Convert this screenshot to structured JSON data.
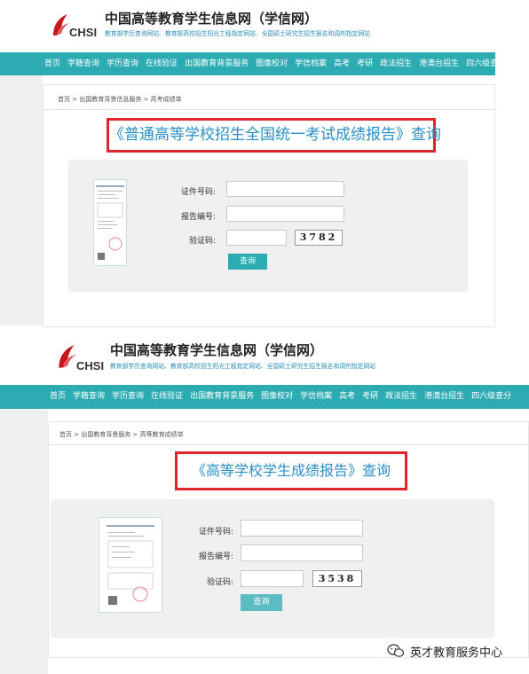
{
  "panel1": {
    "logo_text": "CHSI",
    "site_title": "中国高等教育学生信息网（学信网）",
    "site_subtitle": "教育部学历查询网站、教育部高校招生阳光工程指定网站、全国硕士研究生招生报名和调剂指定网站",
    "nav": [
      "首页",
      "学籍查询",
      "学历查询",
      "在线验证",
      "出国教育背景服务",
      "图像校对",
      "学信档案",
      "高考",
      "考研",
      "政法招生",
      "港澳台招生",
      "四六级查分"
    ],
    "breadcrumb": "首页 > 出国教育背景信息服务 > 高考成绩单",
    "query_title": "《普通高等学校招生全国统一考试成绩报告》查询",
    "form": {
      "id_label": "证件号码:",
      "report_label": "报告编号:",
      "captcha_label": "验证码:",
      "captcha_code": "3782",
      "submit": "查询"
    }
  },
  "panel2": {
    "logo_text": "CHSI",
    "site_title": "中国高等教育学生信息网（学信网）",
    "site_subtitle": "教育部学历查询网站、教育部高校招生阳光工程指定网站、全国硕士研究生招生报名和调剂指定网站",
    "nav": [
      "首页",
      "学籍查询",
      "学历查询",
      "在线验证",
      "出国教育背景服务",
      "图像校对",
      "学信档案",
      "高考",
      "考研",
      "政法招生",
      "港澳台招生",
      "四六级查分"
    ],
    "breadcrumb": "首页 > 出国教育背景服务 > 高等教育成绩单",
    "query_title": "《高等学校学生成绩报告》查询",
    "form": {
      "id_label": "证件号码:",
      "report_label": "报告编号:",
      "captcha_label": "验证码:",
      "captcha_code": "3538",
      "submit": "查询"
    }
  },
  "watermark": {
    "text": "英才教育服务中心"
  },
  "colors": {
    "nav_bg": "#2cabb3",
    "highlight_border": "#e0262c",
    "title_blue": "#2b8fc4",
    "subtitle_blue": "#2a8fb8",
    "logo_red": "#c8161d"
  }
}
